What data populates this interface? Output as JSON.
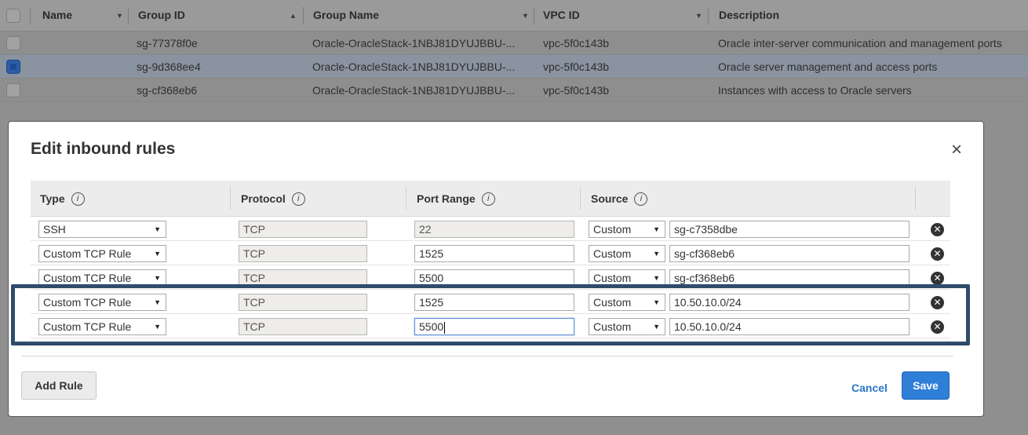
{
  "table": {
    "headers": [
      "Name",
      "Group ID",
      "Group Name",
      "VPC ID",
      "Description"
    ],
    "rows": [
      {
        "group_id": "sg-77378f0e",
        "group_name": "Oracle-OracleStack-1NBJ81DYUJBBU-...",
        "vpc_id": "vpc-5f0c143b",
        "description": "Oracle inter-server communication and management ports",
        "selected": false
      },
      {
        "group_id": "sg-9d368ee4",
        "group_name": "Oracle-OracleStack-1NBJ81DYUJBBU-...",
        "vpc_id": "vpc-5f0c143b",
        "description": "Oracle server management and access ports",
        "selected": true
      },
      {
        "group_id": "sg-cf368eb6",
        "group_name": "Oracle-OracleStack-1NBJ81DYUJBBU-...",
        "vpc_id": "vpc-5f0c143b",
        "description": "Instances with access to Oracle servers",
        "selected": false
      }
    ]
  },
  "modal": {
    "title": "Edit inbound rules",
    "close": "×",
    "columns": {
      "type": "Type",
      "protocol": "Protocol",
      "port_range": "Port Range",
      "source": "Source",
      "info": "i"
    },
    "rules": [
      {
        "type": "SSH",
        "protocol": "TCP",
        "port": "22",
        "source_type": "Custom",
        "source": "sg-c7358dbe"
      },
      {
        "type": "Custom TCP Rule",
        "protocol": "TCP",
        "port": "1525",
        "source_type": "Custom",
        "source": "sg-cf368eb6"
      },
      {
        "type": "Custom TCP Rule",
        "protocol": "TCP",
        "port": "5500",
        "source_type": "Custom",
        "source": "sg-cf368eb6"
      },
      {
        "type": "Custom TCP Rule",
        "protocol": "TCP",
        "port": "1525",
        "source_type": "Custom",
        "source": "10.50.10.0/24"
      },
      {
        "type": "Custom TCP Rule",
        "protocol": "TCP",
        "port": "5500",
        "source_type": "Custom",
        "source": "10.50.10.0/24"
      }
    ],
    "add_rule": "Add Rule",
    "cancel": "Cancel",
    "save": "Save"
  }
}
